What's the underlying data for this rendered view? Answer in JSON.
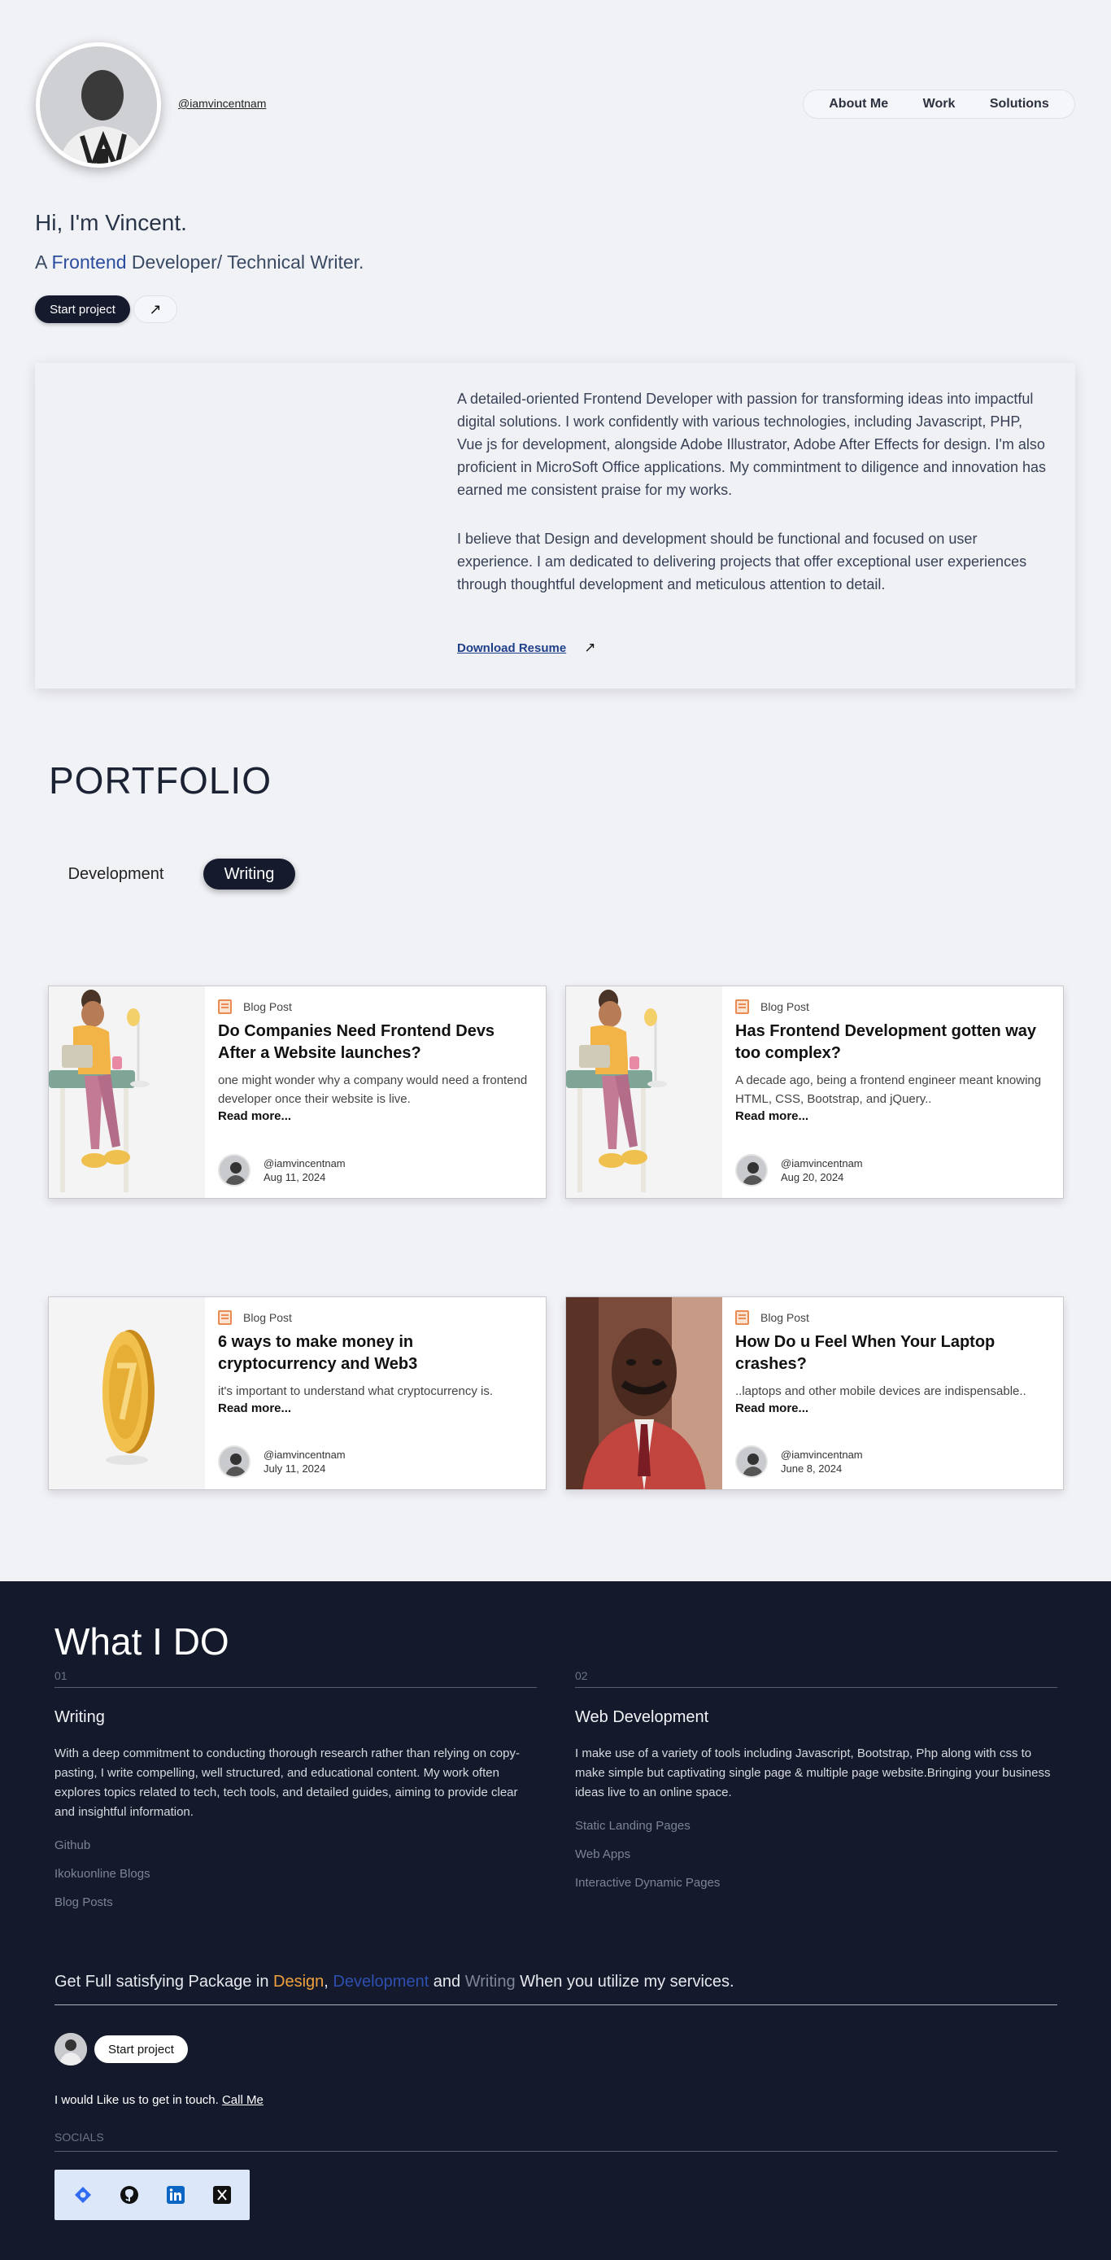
{
  "header": {
    "handle": "@iamvincentnam",
    "nav": [
      "About Me",
      "Work",
      "Solutions"
    ]
  },
  "hero": {
    "greeting": "Hi, I'm Vincent.",
    "sub_prefix": "A ",
    "sub_accent": "Frontend",
    "sub_suffix": " Developer/ Technical Writer.",
    "cta": "Start project",
    "cta_arrow": "↗"
  },
  "about": {
    "p1": "A detailed-oriented Frontend Developer with passion for transforming ideas into impactful digital solutions. I work confidently with various technologies, including Javascript, PHP, Vue js for development, alongside Adobe Illustrator, Adobe After Effects for design. I'm also proficient in MicroSoft Office applications. My commintment to diligence and innovation has earned me consistent praise for my works.",
    "p2": "I believe that Design and development should be functional and focused on user experience. I am dedicated to delivering projects that offer exceptional user experiences through thoughtful development and meticulous attention to detail.",
    "download": "Download Resume",
    "download_arrow": "↗"
  },
  "portfolio": {
    "title": "PORTFOLIO",
    "tabs": [
      "Development",
      "Writing"
    ],
    "active_tab": "Writing",
    "posts": [
      {
        "type": "Blog Post",
        "title": "Do Companies Need Frontend Devs After a Website launches?",
        "excerpt": "one might wonder why a company would need a frontend developer once their website is live.",
        "read_more": "Read more...",
        "author": "@iamvincentnam",
        "date": "Aug 11, 2024",
        "thumb": "desk-character"
      },
      {
        "type": "Blog Post",
        "title": "Has Frontend Development gotten way too complex?",
        "excerpt": "A decade ago, being a frontend engineer meant knowing HTML, CSS, Bootstrap, and jQuery..",
        "read_more": "Read more...",
        "author": "@iamvincentnam",
        "date": "Aug 20, 2024",
        "thumb": "desk-character"
      },
      {
        "type": "Blog Post",
        "title": "6 ways to make money in cryptocurrency and Web3",
        "excerpt": "it's important to understand what cryptocurrency is.",
        "read_more": "Read more...",
        "author": "@iamvincentnam",
        "date": "July 11, 2024",
        "thumb": "gold-coin"
      },
      {
        "type": "Blog Post",
        "title": "How Do u Feel When Your Laptop crashes?",
        "excerpt": "..laptops and other mobile devices are indispensable..",
        "read_more": "Read more...",
        "author": "@iamvincentnam",
        "date": "June 8, 2024",
        "thumb": "man-portrait"
      }
    ]
  },
  "what_i_do": {
    "title": "What I DO",
    "columns": [
      {
        "num": "01",
        "title": "Writing",
        "desc": "With a deep commitment to conducting thorough research rather than relying on copy-pasting, I write compelling, well structured, and educational content. My work often explores topics related to tech, tech tools, and detailed guides, aiming to provide clear and insightful information.",
        "links": [
          "Github",
          "Ikokuonline Blogs",
          "Blog Posts"
        ]
      },
      {
        "num": "02",
        "title": "Web Development",
        "desc": "I make use of a variety of tools including Javascript, Bootstrap, Php along with css to make simple but captivating single page & multiple page website.Bringing your business ideas live to an online space.",
        "links": [
          "Static Landing Pages",
          "Web Apps",
          "Interactive Dynamic Pages"
        ]
      }
    ],
    "package": {
      "prefix": "Get Full satisfying Package in ",
      "design": "Design",
      "comma": ", ",
      "development": "Development",
      "and": " and ",
      "writing": "Writing",
      "suffix": " When you utilize my services."
    },
    "cta": "Start project",
    "touch_prefix": "I would Like us to get in touch. ",
    "touch_link": "Call Me",
    "socials_label": "SOCIALS",
    "socials": [
      "website-icon",
      "github-icon",
      "linkedin-icon",
      "x-icon"
    ]
  },
  "colors": {
    "page_bg": "#f1f2f6",
    "dark_bg": "#141a2b",
    "button_dark": "#151b2d",
    "accent_blue": "#2b4c9e",
    "accent_orange": "#f0a13d"
  }
}
